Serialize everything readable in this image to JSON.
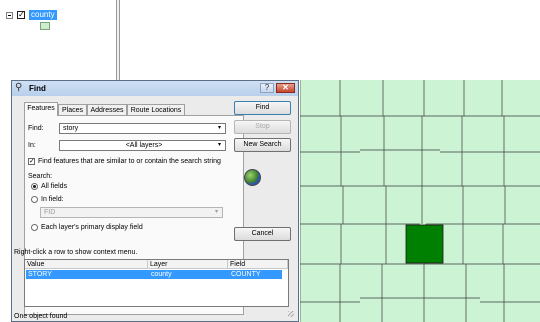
{
  "toc": {
    "expander": "⊟",
    "checkbox": "✓",
    "layer_name": "county"
  },
  "dialog": {
    "title": "Find",
    "help": "?",
    "close": "✕",
    "tabs": [
      "Features",
      "Places",
      "Addresses",
      "Route Locations"
    ],
    "find_label": "Find:",
    "find_value": "story",
    "in_label": "In:",
    "in_value": "<All layers>",
    "similar_checked": "✓",
    "similar_label": "Find features that are similar to or contain the search string",
    "search_label": "Search:",
    "radio_all": "All fields",
    "radio_in_field": "In field:",
    "field_value": "FID",
    "radio_primary": "Each layer's primary display field",
    "buttons": {
      "find": "Find",
      "stop": "Stop",
      "new_search": "New Search",
      "cancel": "Cancel"
    },
    "hint": "Right-click a row to show context menu.",
    "columns": [
      "Value",
      "Layer",
      "Field"
    ],
    "rows": [
      {
        "value": "STORY",
        "layer": "county",
        "field": "COUNTY"
      }
    ],
    "status": "One object found",
    "arrow": "▾"
  },
  "colors": {
    "map_fill": "#ccf4d4",
    "selected_fill": "#008000",
    "selection_blue": "#3399ff"
  }
}
